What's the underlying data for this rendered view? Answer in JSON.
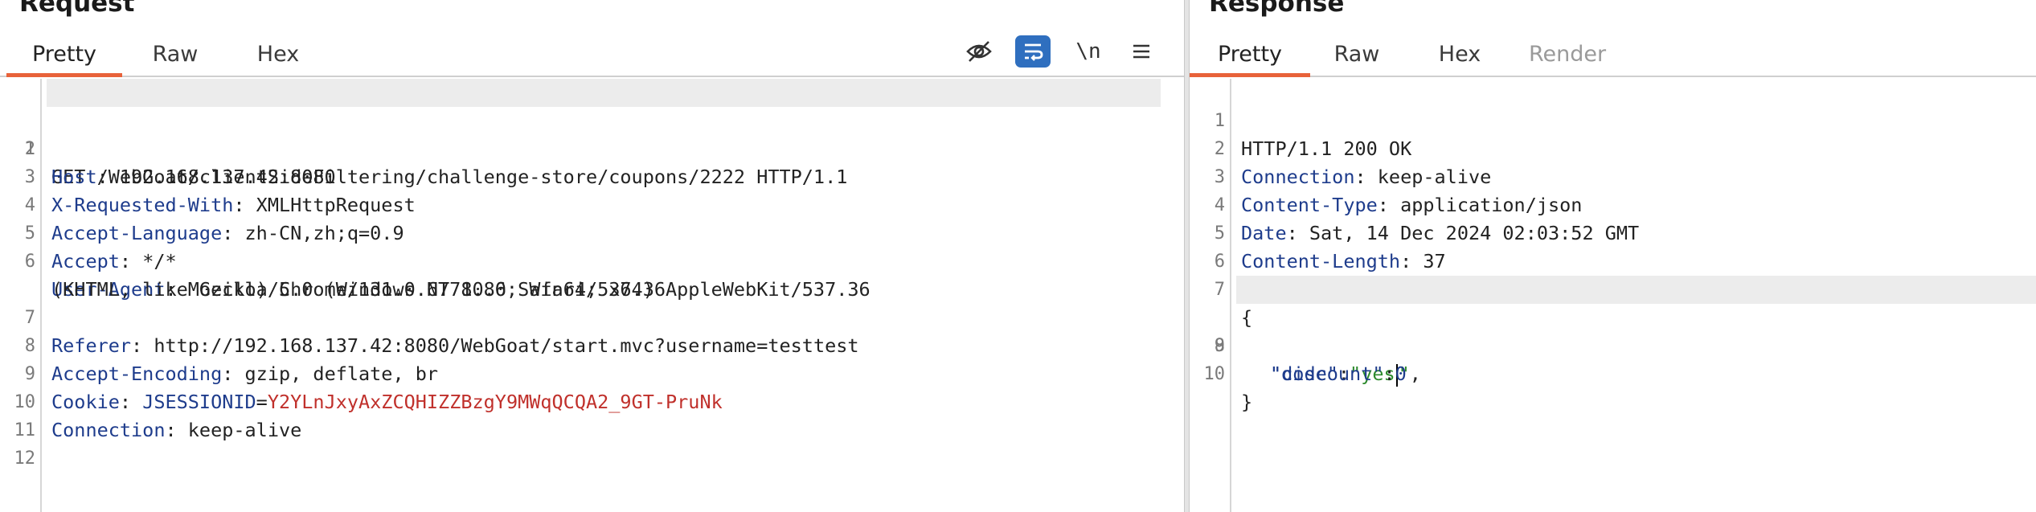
{
  "request": {
    "title": "Request",
    "tabs": [
      {
        "label": "Pretty",
        "active": true
      },
      {
        "label": "Raw",
        "active": false
      },
      {
        "label": "Hex",
        "active": false
      }
    ],
    "toolbar": {
      "hide_icon": "eye-slash-icon",
      "wrap_icon": "word-wrap-icon",
      "newline_label": "\\n",
      "menu_icon": "hamburger-menu-icon"
    },
    "lines": [
      {
        "n": "1",
        "text": "GET /WebGoat/clientSideFiltering/challenge-store/coupons/2222 HTTP/1.1"
      },
      {
        "n": "2",
        "name": "Host",
        "value": "192.168.137.42:8080"
      },
      {
        "n": "3",
        "name": "X-Requested-With",
        "value": "XMLHttpRequest"
      },
      {
        "n": "4",
        "name": "Accept-Language",
        "value": "zh-CN,zh;q=0.9"
      },
      {
        "n": "5",
        "name": "Accept",
        "value": "*/*"
      },
      {
        "n": "6",
        "name": "User-Agent",
        "value": "Mozilla/5.0 (Windows NT 10.0; Win64; x64) AppleWebKit/537.36"
      },
      {
        "n": "",
        "text": "(KHTML, like Gecko) Chrome/131.0.6778.86 Safari/537.36"
      },
      {
        "n": "7",
        "name": "Referer",
        "value": "http://192.168.137.42:8080/WebGoat/start.mvc?username=testtest"
      },
      {
        "n": "8",
        "name": "Accept-Encoding",
        "value": "gzip, deflate, br"
      },
      {
        "n": "9",
        "name": "Cookie",
        "cookie_name": "JSESSIONID",
        "cookie_value": "Y2YLnJxyAxZCQHIZZBzgY9MWqQCQA2_9GT-PruNk"
      },
      {
        "n": "10",
        "name": "Connection",
        "value": "keep-alive"
      },
      {
        "n": "11",
        "text": ""
      },
      {
        "n": "12",
        "text": ""
      }
    ]
  },
  "response": {
    "title": "Response",
    "tabs": [
      {
        "label": "Pretty",
        "active": true
      },
      {
        "label": "Raw",
        "active": false
      },
      {
        "label": "Hex",
        "active": false
      },
      {
        "label": "Render",
        "active": false,
        "disabled": true
      }
    ],
    "lines": [
      {
        "n": "1",
        "text": "HTTP/1.1 200 OK"
      },
      {
        "n": "2",
        "name": "Connection",
        "value": "keep-alive"
      },
      {
        "n": "3",
        "name": "Content-Type",
        "value": "application/json"
      },
      {
        "n": "4",
        "name": "Date",
        "value": "Sat, 14 Dec 2024 02:03:52 GMT"
      },
      {
        "n": "5",
        "name": "Content-Length",
        "value": "37"
      },
      {
        "n": "6",
        "text": ""
      },
      {
        "n": "7",
        "text": "{"
      },
      {
        "n": "8",
        "key": "\"code\"",
        "sep": ":",
        "str_before": "\"yes",
        "str_after": "\"",
        "tail": ","
      },
      {
        "n": "9",
        "key": "\"discount\"",
        "sep": ":",
        "num": "0"
      },
      {
        "n": "10",
        "text": "}"
      }
    ]
  },
  "colors": {
    "accent_tab": "#e8623a",
    "header_name": "#1e3c8c",
    "cookie_value": "#c0302b",
    "json_string": "#2c8a2c",
    "toggle_on": "#2f6fbf"
  }
}
